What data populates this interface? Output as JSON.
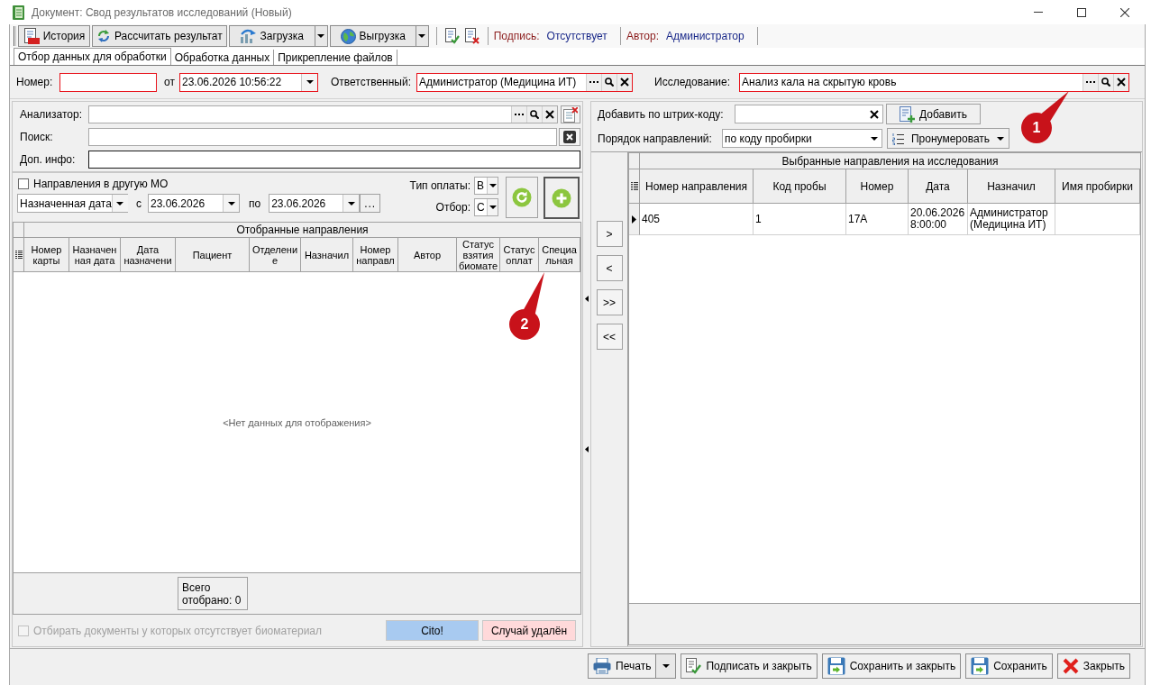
{
  "window": {
    "title": "Документ: Свод результатов исследований (Новый)"
  },
  "toolbar": {
    "buttons": [
      {
        "label": "История",
        "kind": "plain"
      },
      {
        "label": "Рассчитать результат",
        "kind": "plain"
      },
      {
        "label": "Загрузка",
        "kind": "split"
      },
      {
        "label": "Выгрузка",
        "kind": "split"
      }
    ],
    "signature": {
      "label": "Подпись:",
      "value": "Отсутствует"
    },
    "author": {
      "label": "Автор:",
      "value": "Администратор"
    }
  },
  "tabs": [
    {
      "label": "Отбор данных для обработки",
      "selected": true
    },
    {
      "label": "Обработка данных",
      "selected": false
    },
    {
      "label": "Прикрепление файлов",
      "selected": false
    }
  ],
  "document_fields": {
    "number": {
      "label": "Номер:",
      "required": true
    },
    "date": {
      "label": "от",
      "value": "23.06.2026 10:56:22",
      "required": true
    },
    "responsible": {
      "label": "Ответственный:",
      "value": "Администратор (Медицина ИТ)",
      "required": true
    },
    "study": {
      "label": "Исследование:",
      "value": "Анализ кала на скрытую кровь",
      "required": true
    }
  },
  "filters": {
    "analyzer": {
      "label": "Анализатор:"
    },
    "search": {
      "label": "Поиск:"
    },
    "extra_info": {
      "label": "Доп. инфо:"
    },
    "other_mo": {
      "label": "Направления в другую МО",
      "checked": false
    },
    "date_kind": {
      "value": "Назначенная дата"
    },
    "date_from": {
      "label": "с",
      "value": "23.06.2026"
    },
    "date_to": {
      "label": "по",
      "value": "23.06.2026"
    },
    "period_button": "...",
    "payment_type": {
      "label": "Тип оплаты:",
      "value": "В"
    },
    "selection": {
      "label": "Отбор:",
      "value": "С"
    }
  },
  "selected_table": {
    "title": "Отобранные направления",
    "columns": [
      "Номер карты",
      "Назначенная дата",
      "Дата назначени",
      "Пациент",
      "Отделение",
      "Назначил",
      "Номер направл",
      "Автор",
      "Статус взятия биомате",
      "Статус оплат",
      "Специальная"
    ],
    "empty_text": "<Нет данных для отображения>",
    "total": "Всего отобрано: 0"
  },
  "no_biomaterial": {
    "label": "Отбирать документы у которых отсутствует биоматериал",
    "checked": false,
    "disabled": true
  },
  "legend": [
    {
      "label": "Cito!",
      "color": "#a8caf0"
    },
    {
      "label": "Случай удалён",
      "color": "#ffd9da"
    }
  ],
  "transfer_buttons": [
    ">",
    "<",
    ">>",
    "<<"
  ],
  "barcode": {
    "label": "Добавить по штрих-коду:"
  },
  "add_button": "Добавить",
  "order": {
    "label": "Порядок направлений:",
    "value": "по коду пробирки"
  },
  "number_button": "Пронумеровать",
  "chosen_table": {
    "title": "Выбранные направления на исследования",
    "columns": [
      "Номер направления",
      "Код пробы",
      "Номер",
      "Дата",
      "Назначил",
      "Имя пробирки"
    ],
    "rows": [
      {
        "cells": [
          "405",
          "1",
          "17А",
          "20.06.2026 8:00:00",
          "Администратор (Медицина ИТ)"
        ],
        "selected": true
      }
    ]
  },
  "footer_buttons": [
    {
      "label": "Печать",
      "kind": "split"
    },
    {
      "label": "Подписать и закрыть",
      "kind": "plain"
    },
    {
      "label": "Сохранить и закрыть",
      "kind": "plain"
    },
    {
      "label": "Сохранить",
      "kind": "plain"
    },
    {
      "label": "Закрыть",
      "kind": "plain"
    }
  ],
  "callouts": [
    {
      "label": "1"
    },
    {
      "label": "2"
    }
  ]
}
